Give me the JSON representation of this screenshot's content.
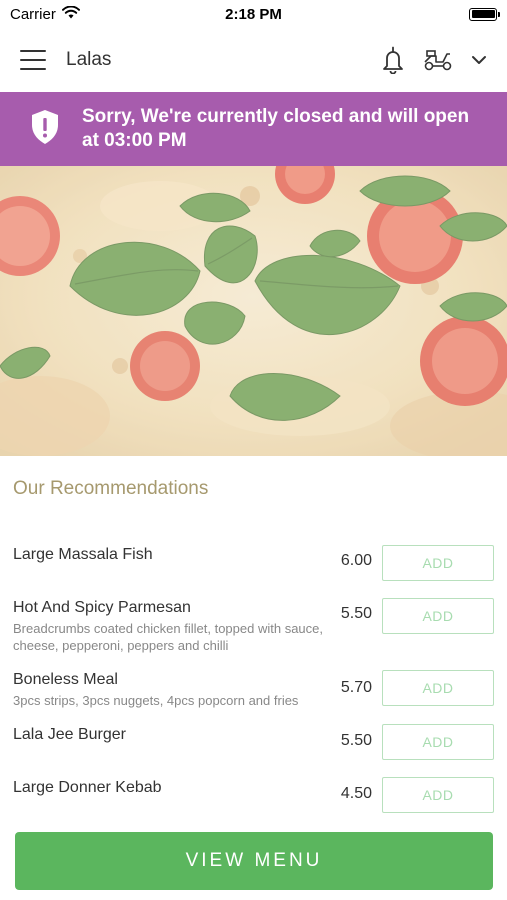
{
  "status_bar": {
    "carrier": "Carrier",
    "time": "2:18 PM",
    "battery_level": 1.0
  },
  "header": {
    "store_name": "Lalas",
    "icons": [
      "menu-icon",
      "bell-icon",
      "scooter-icon",
      "chevron-down-icon"
    ]
  },
  "banner": {
    "message": "Sorry, We're currently closed and will open at 03:00 PM",
    "background_color": "#a75cad",
    "icon": "shield-alert-icon"
  },
  "recommendations": {
    "title": "Our Recommendations",
    "items": [
      {
        "name": "Large Massala Fish",
        "description": "",
        "price": "6.00",
        "button_label": "ADD"
      },
      {
        "name": "Hot And Spicy Parmesan",
        "description": "Breadcrumbs coated chicken fillet, topped with sauce,  cheese, pepperoni, peppers and chilli",
        "price": "5.50",
        "button_label": "ADD"
      },
      {
        "name": "Boneless Meal",
        "description": "3pcs strips, 3pcs nuggets, 4pcs popcorn and fries",
        "price": "5.70",
        "button_label": "ADD"
      },
      {
        "name": "Lala Jee Burger",
        "description": "",
        "price": "5.50",
        "button_label": "ADD"
      },
      {
        "name": "Large Donner Kebab",
        "description": "",
        "price": "4.50",
        "button_label": "ADD"
      }
    ]
  },
  "footer": {
    "view_menu_label": "VIEW MENU",
    "button_color": "#5bb65e"
  }
}
